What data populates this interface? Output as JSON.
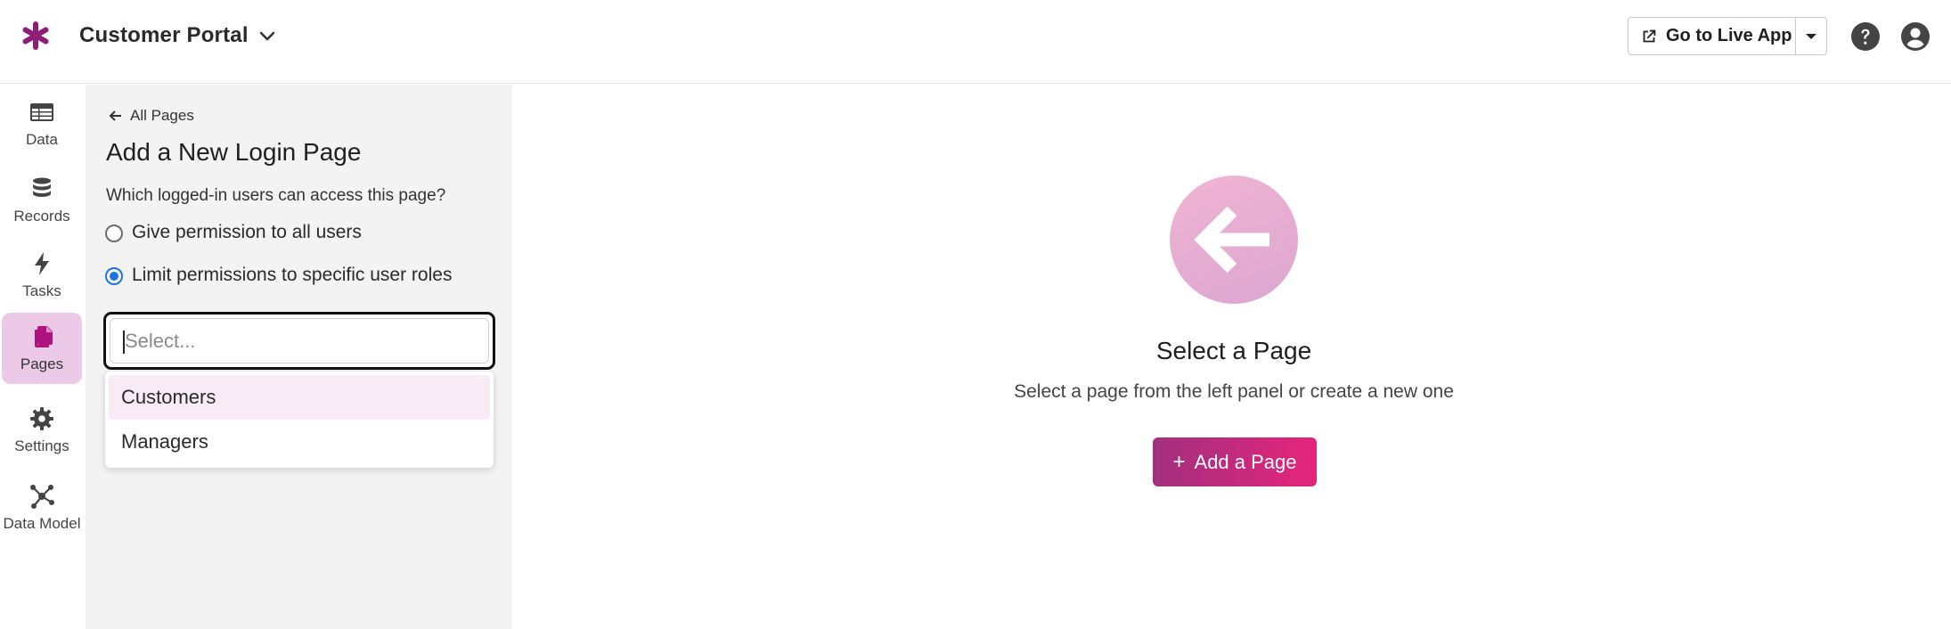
{
  "header": {
    "app_title": "Customer Portal",
    "live_button_label": "Go to Live App"
  },
  "rail": {
    "items": [
      {
        "label": "Data",
        "icon": "table-icon"
      },
      {
        "label": "Records",
        "icon": "database-icon"
      },
      {
        "label": "Tasks",
        "icon": "bolt-icon"
      },
      {
        "label": "Pages",
        "icon": "pages-icon",
        "active": true
      },
      {
        "label": "Settings",
        "icon": "gear-icon"
      },
      {
        "label": "Data Model",
        "icon": "graph-icon"
      }
    ]
  },
  "panel": {
    "back_label": "All Pages",
    "title": "Add a New Login Page",
    "question": "Which logged-in users can access this page?",
    "options": [
      {
        "label": "Give permission to all users",
        "checked": false
      },
      {
        "label": "Limit permissions to specific user roles",
        "checked": true
      }
    ],
    "select_placeholder": "Select...",
    "dropdown_options": [
      "Customers",
      "Managers"
    ]
  },
  "main": {
    "empty_title": "Select a Page",
    "empty_subtitle": "Select a page from the left panel or create a new one",
    "add_button_label": "Add a Page"
  },
  "colors": {
    "brand": "#8e1e74",
    "accent_gradient_start": "#a2307f",
    "accent_gradient_end": "#e5247b",
    "active_nav_bg": "#ecc9e6",
    "radio_checked": "#1a73e8"
  }
}
